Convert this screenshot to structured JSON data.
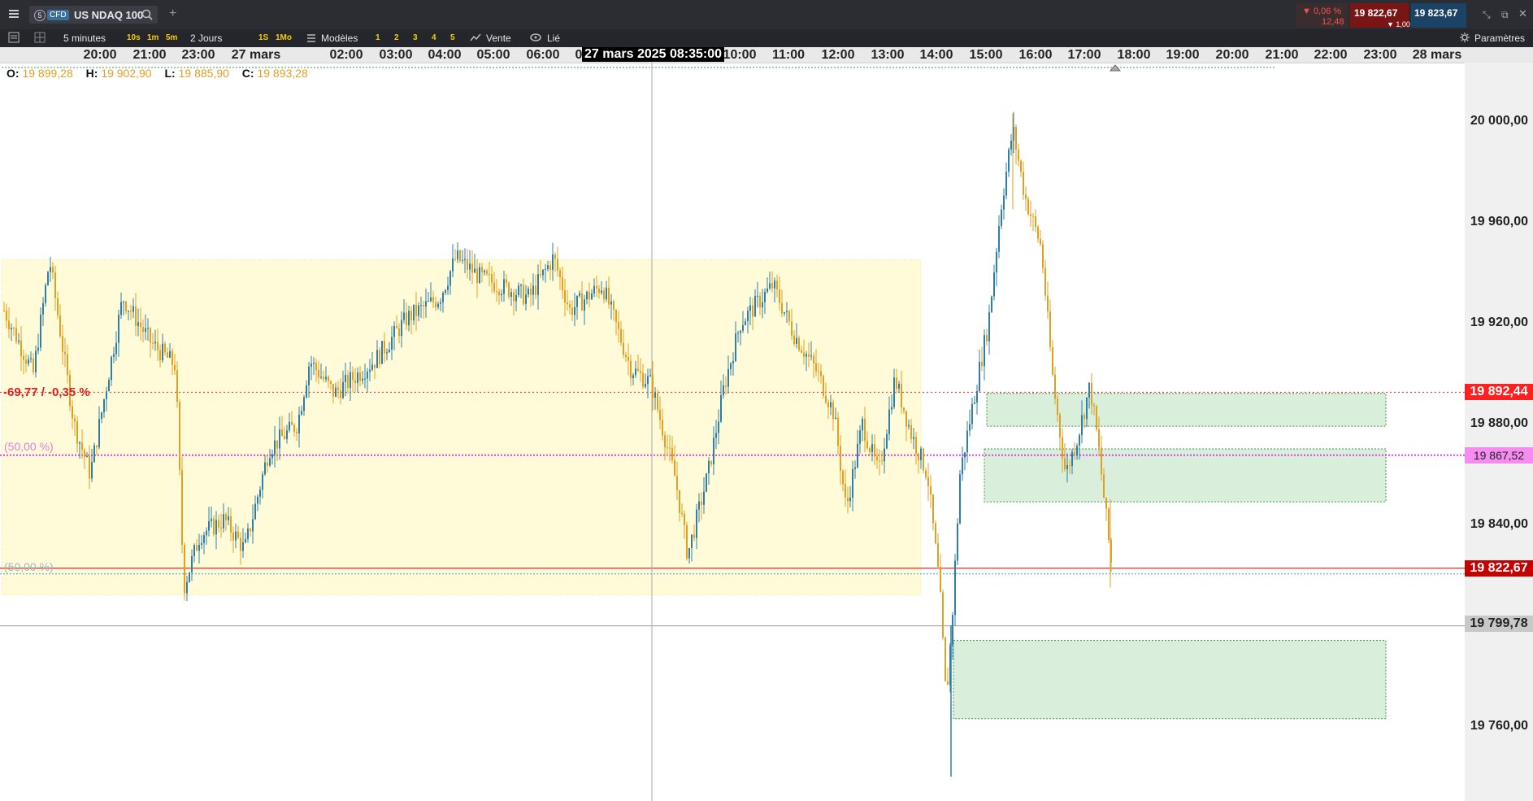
{
  "instrument": {
    "badge_number": "5",
    "badge_type": "CFD",
    "name": "US NDAQ 100",
    "change_pct": "▼ 0,06 %",
    "change_abs": "12,48",
    "sell_price": "19 822,67",
    "buy_price": "19 823,67",
    "spread": "▼ 1,00"
  },
  "toolbar": {
    "timeframe": "5 minutes",
    "quick_tf": [
      "10s",
      "1m",
      "5m"
    ],
    "range": "2 Jours",
    "range_quick": [
      "1S",
      "1Mo"
    ],
    "models_label": "Modèles",
    "layout_slots": [
      "1",
      "2",
      "3",
      "4",
      "5"
    ],
    "vente_label": "Vente",
    "lie_label": "Lié",
    "params_label": "Paramètres"
  },
  "time_axis": {
    "labels": [
      "20:00",
      "21:00",
      "23:00",
      "27 mars",
      "02:00",
      "03:00",
      "04:00",
      "05:00",
      "06:00",
      "0",
      "10:00",
      "11:00",
      "12:00",
      "13:00",
      "14:00",
      "15:00",
      "16:00",
      "17:00",
      "18:00",
      "19:00",
      "20:00",
      "21:00",
      "22:00",
      "23:00",
      "28 mars"
    ],
    "crosshair_label": "27 mars 2025 08:35:00"
  },
  "ohlc": {
    "o_label": "O:",
    "o": "19 899,28",
    "h_label": "H:",
    "h": "19 902,90",
    "l_label": "L:",
    "l": "19 885,90",
    "c_label": "C:",
    "c": "19 893,28"
  },
  "price_axis": {
    "labels": [
      "20 000,00",
      "19 960,00",
      "19 920,00",
      "19 880,00",
      "19 840,00",
      "19 760,00"
    ],
    "tag_red": "19 892,44",
    "tag_magenta": "19 867,52",
    "tag_current": "19 822,67",
    "tag_cross": "19 799,78"
  },
  "annotations": {
    "change_label": "-69,77 / -0,35 %",
    "fib_upper": "(50,00 %)",
    "fib_lower": "(50,00 %)"
  },
  "colors": {
    "bull": "#2d7fa8",
    "bear": "#e0a020",
    "current_price": "#c40000",
    "change_line": "#ff2a2a",
    "magenta": "#e040e0",
    "zone_yellow": "#fffbd8",
    "zone_green": "#d9eedb"
  },
  "chart_data": {
    "type": "candlestick",
    "y_range": [
      19740,
      20020
    ],
    "grid": false,
    "crosshair_price": 19799.78,
    "current_price": 19822.67,
    "price_lines": [
      19892.44,
      19867.52,
      19822.67
    ],
    "zones": [
      {
        "kind": "yellow",
        "high": 19945,
        "low": 19812
      },
      {
        "kind": "green",
        "high": 19892,
        "low": 19879
      },
      {
        "kind": "green",
        "high": 19870,
        "low": 19849
      },
      {
        "kind": "green",
        "high": 19794,
        "low": 19763
      }
    ]
  }
}
